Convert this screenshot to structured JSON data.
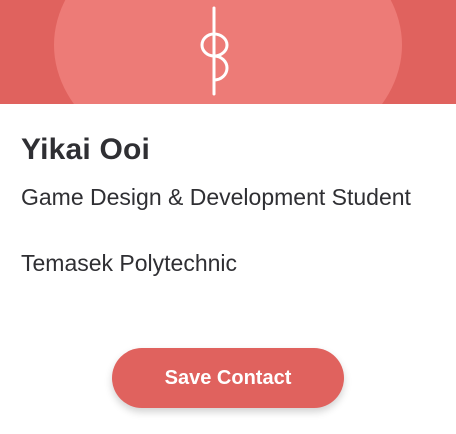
{
  "profile": {
    "name": "Yikai Ooi",
    "title": "Game Design & Development Student",
    "organization": "Temasek Polytechnic"
  },
  "header": {
    "logo_icon": "bp-logo-icon"
  },
  "actions": {
    "save_contact_label": "Save Contact"
  },
  "colors": {
    "accent": "#e0625e",
    "accent_light": "#ed7b77",
    "text": "#2f2f33"
  }
}
